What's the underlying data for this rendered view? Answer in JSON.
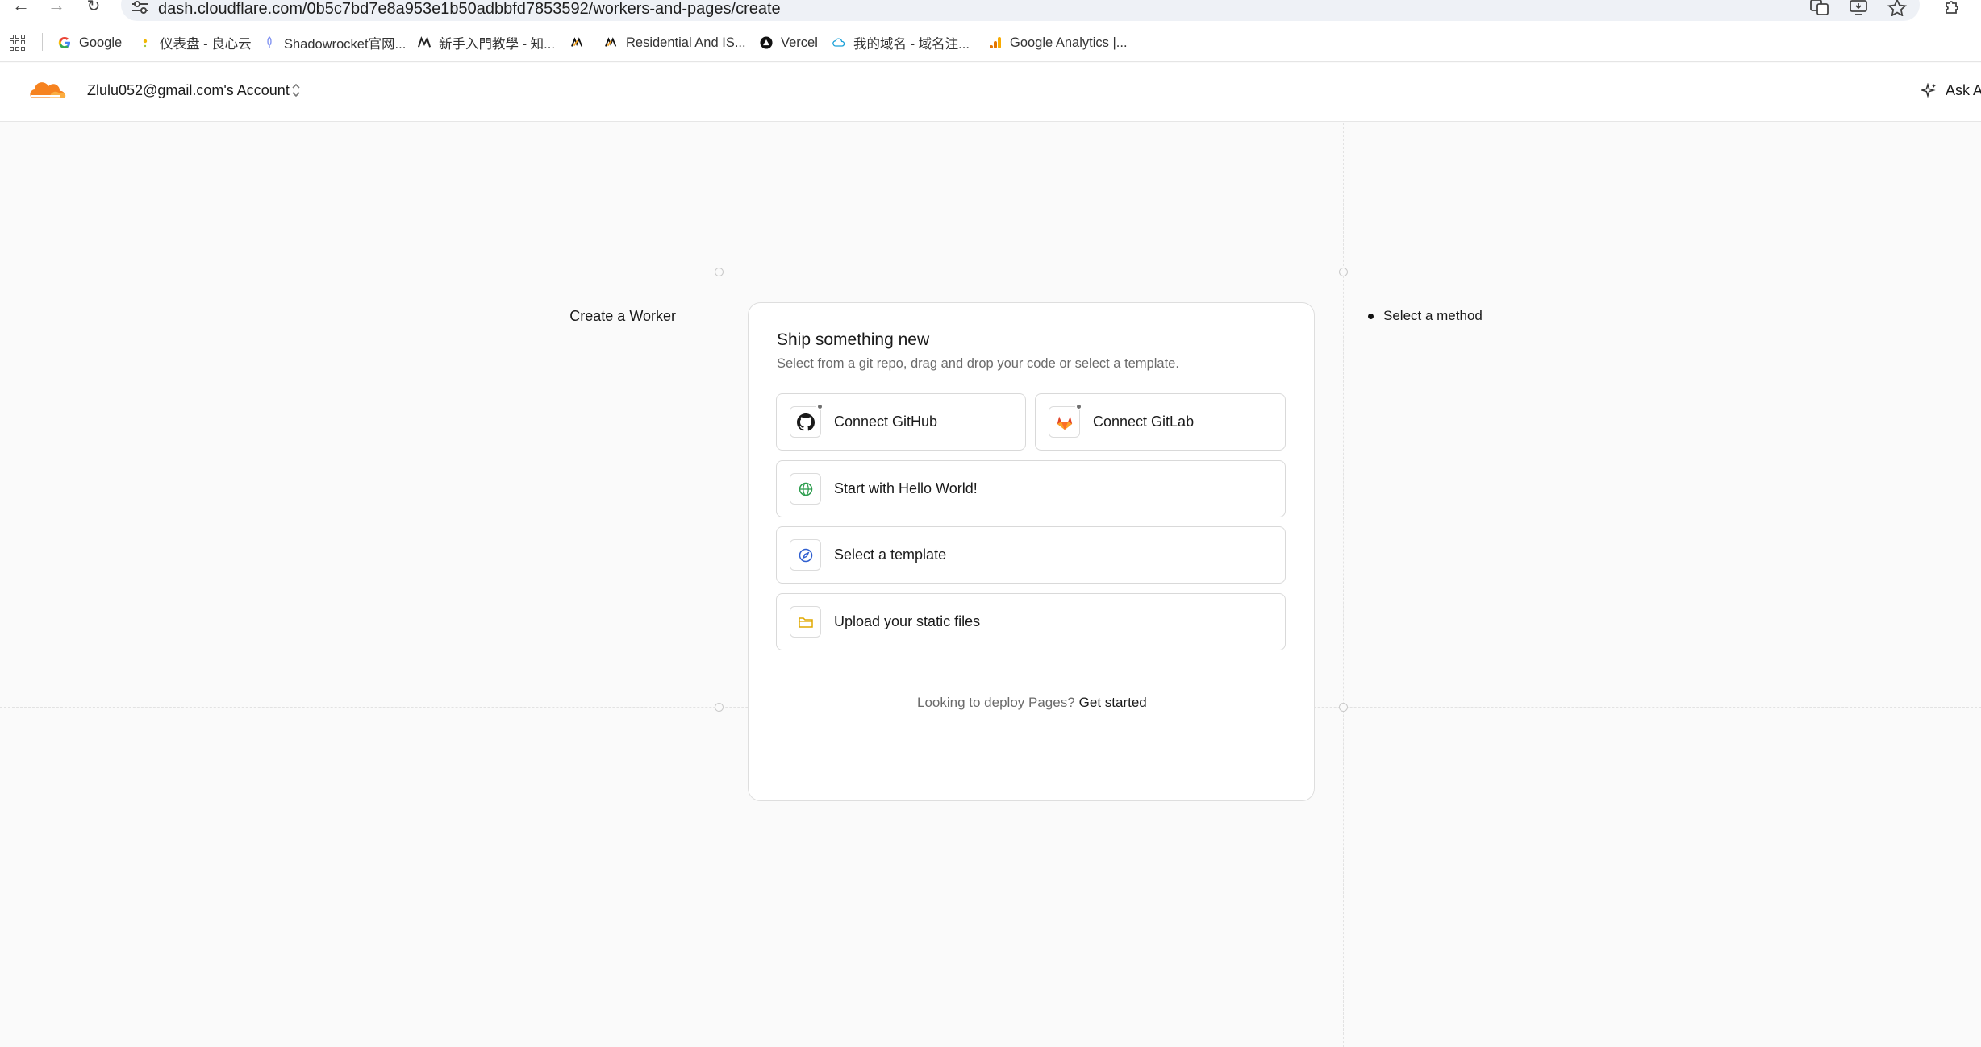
{
  "browser": {
    "url": "dash.cloudflare.com/0b5c7bd7e8a953e1b50adbbfd7853592/workers-and-pages/create",
    "bookmarks": [
      {
        "label": "Google",
        "icon": "google-icon"
      },
      {
        "label": "仪表盘 - 良心云",
        "icon": "dot-icon"
      },
      {
        "label": "Shadowrocket官网...",
        "icon": "rocket-icon"
      },
      {
        "label": "新手入門教學 - 知...",
        "icon": "m-logo-icon"
      },
      {
        "label": "",
        "icon": "orange-logo-icon"
      },
      {
        "label": "Residential And IS...",
        "icon": "orange-logo-icon"
      },
      {
        "label": "Vercel",
        "icon": "vercel-icon"
      },
      {
        "label": "我的域名 - 域名注...",
        "icon": "cloud-icon"
      },
      {
        "label": "Google Analytics |...",
        "icon": "analytics-icon"
      }
    ]
  },
  "header": {
    "account": "Zlulu052@gmail.com's Account",
    "ask_ai": "Ask A"
  },
  "page": {
    "step_title": "Create a Worker",
    "steps": [
      "Select a method"
    ],
    "card_title": "Ship something new",
    "card_subtitle": "Select from a git repo, drag and drop your code or select a template.",
    "options": {
      "github": "Connect GitHub",
      "gitlab": "Connect GitLab",
      "hello": "Start with Hello World!",
      "template": "Select a template",
      "upload": "Upload your static files"
    },
    "footer_text": "Looking to deploy Pages?",
    "footer_link": "Get started"
  },
  "colors": {
    "accent_orange": "#f6821f",
    "globe_green": "#2e9e4f",
    "compass_blue": "#2f5fd0",
    "folder_yellow": "#e0a800",
    "gitlab_red": "#e24329"
  }
}
